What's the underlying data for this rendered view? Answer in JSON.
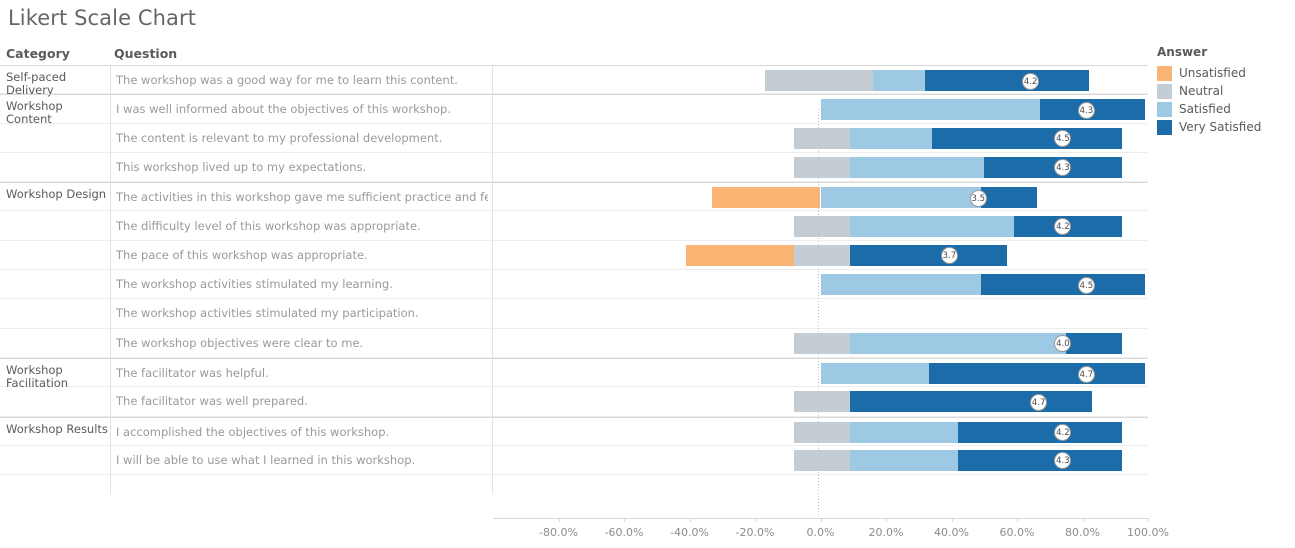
{
  "title": "Likert Scale Chart",
  "columns": {
    "category": "Category",
    "question": "Question"
  },
  "legend": {
    "title": "Answer",
    "items": [
      {
        "label": "Unsatisfied",
        "color": "#f9b474"
      },
      {
        "label": "Neutral",
        "color": "#c4ccd4"
      },
      {
        "label": "Satisfied",
        "color": "#9ec9e5"
      },
      {
        "label": "Very Satisfied",
        "color": "#1b6ca8"
      }
    ]
  },
  "axis": {
    "ticks": [
      "-80.0%",
      "-60.0%",
      "-40.0%",
      "-20.0%",
      "0.0%",
      "20.0%",
      "40.0%",
      "60.0%",
      "80.0%",
      "100.0%"
    ],
    "tick_values": [
      -80,
      -60,
      -40,
      -20,
      0,
      20,
      40,
      60,
      80,
      100
    ],
    "min": -100,
    "max": 100
  },
  "chart_data": {
    "type": "bar",
    "title": "Likert Scale Chart",
    "xlabel": "",
    "ylabel": "",
    "xlim": [
      -100,
      100
    ],
    "grid": false,
    "legend_position": "right",
    "stacked": true,
    "diverging": true,
    "series": [
      {
        "name": "Unsatisfied",
        "color": "#f9b474"
      },
      {
        "name": "Neutral",
        "color": "#c4ccd4"
      },
      {
        "name": "Satisfied",
        "color": "#9ec9e5"
      },
      {
        "name": "Very Satisfied",
        "color": "#1b6ca8"
      }
    ],
    "rows": [
      {
        "category": "Self-paced Delivery",
        "question": "The workshop was a good way for me to learn this content.",
        "score": "4.2",
        "start": -17,
        "segments": [
          {
            "name": "Unsatisfied",
            "value": 0
          },
          {
            "name": "Neutral",
            "value": 33
          },
          {
            "name": "Satisfied",
            "value": 16
          },
          {
            "name": "Very Satisfied",
            "value": 50
          }
        ]
      },
      {
        "category": "Workshop Content",
        "question": "I was well informed about the objectives of this workshop.",
        "score": "4.3",
        "start": 0,
        "segments": [
          {
            "name": "Unsatisfied",
            "value": 0
          },
          {
            "name": "Neutral",
            "value": 0
          },
          {
            "name": "Satisfied",
            "value": 67
          },
          {
            "name": "Very Satisfied",
            "value": 32
          }
        ]
      },
      {
        "category": "",
        "question": "The content is relevant to my professional development.",
        "score": "4.5",
        "start": -8,
        "segments": [
          {
            "name": "Unsatisfied",
            "value": 0
          },
          {
            "name": "Neutral",
            "value": 17
          },
          {
            "name": "Satisfied",
            "value": 25
          },
          {
            "name": "Very Satisfied",
            "value": 58
          }
        ]
      },
      {
        "category": "",
        "question": "This workshop lived up to my expectations.",
        "score": "4.3",
        "start": -8,
        "segments": [
          {
            "name": "Unsatisfied",
            "value": 0
          },
          {
            "name": "Neutral",
            "value": 17
          },
          {
            "name": "Satisfied",
            "value": 41
          },
          {
            "name": "Very Satisfied",
            "value": 42
          }
        ]
      },
      {
        "category": "Workshop Design",
        "question": "The activities in this workshop gave me sufficient practice and feedback.",
        "score": "3.5",
        "start": -33,
        "segments": [
          {
            "name": "Unsatisfied",
            "value": 33
          },
          {
            "name": "Neutral",
            "value": 0
          },
          {
            "name": "Satisfied",
            "value": 49
          },
          {
            "name": "Very Satisfied",
            "value": 17
          }
        ]
      },
      {
        "category": "",
        "question": "The difficulty level of this workshop was appropriate.",
        "score": "4.2",
        "start": -8,
        "segments": [
          {
            "name": "Unsatisfied",
            "value": 0
          },
          {
            "name": "Neutral",
            "value": 17
          },
          {
            "name": "Satisfied",
            "value": 50
          },
          {
            "name": "Very Satisfied",
            "value": 33
          }
        ]
      },
      {
        "category": "",
        "question": "The pace of this workshop was appropriate.",
        "score": "3.7",
        "start": -41,
        "segments": [
          {
            "name": "Unsatisfied",
            "value": 33
          },
          {
            "name": "Neutral",
            "value": 17
          },
          {
            "name": "Satisfied",
            "value": 0
          },
          {
            "name": "Very Satisfied",
            "value": 48
          }
        ]
      },
      {
        "category": "",
        "question": "The workshop activities stimulated my learning.",
        "score": "4.5",
        "start": 0,
        "segments": [
          {
            "name": "Unsatisfied",
            "value": 0
          },
          {
            "name": "Neutral",
            "value": 0
          },
          {
            "name": "Satisfied",
            "value": 49
          },
          {
            "name": "Very Satisfied",
            "value": 50
          }
        ]
      },
      {
        "category": "",
        "question": "The workshop activities stimulated my participation.",
        "score": "",
        "start": 0,
        "segments": [
          {
            "name": "Unsatisfied",
            "value": 0
          },
          {
            "name": "Neutral",
            "value": 0
          },
          {
            "name": "Satisfied",
            "value": 0
          },
          {
            "name": "Very Satisfied",
            "value": 0
          }
        ]
      },
      {
        "category": "",
        "question": "The workshop objectives were clear to me.",
        "score": "4.0",
        "start": -8,
        "segments": [
          {
            "name": "Unsatisfied",
            "value": 0
          },
          {
            "name": "Neutral",
            "value": 17
          },
          {
            "name": "Satisfied",
            "value": 66
          },
          {
            "name": "Very Satisfied",
            "value": 17
          }
        ]
      },
      {
        "category": "Workshop Facilitation",
        "question": "The facilitator was helpful.",
        "score": "4.7",
        "start": 0,
        "segments": [
          {
            "name": "Unsatisfied",
            "value": 0
          },
          {
            "name": "Neutral",
            "value": 0
          },
          {
            "name": "Satisfied",
            "value": 33
          },
          {
            "name": "Very Satisfied",
            "value": 66
          }
        ]
      },
      {
        "category": "",
        "question": "The facilitator was well prepared.",
        "score": "4.7",
        "start": -8,
        "segments": [
          {
            "name": "Unsatisfied",
            "value": 0
          },
          {
            "name": "Neutral",
            "value": 17
          },
          {
            "name": "Satisfied",
            "value": 0
          },
          {
            "name": "Very Satisfied",
            "value": 74
          }
        ]
      },
      {
        "category": "Workshop Results",
        "question": "I accomplished the objectives of this workshop.",
        "score": "4.2",
        "start": -8,
        "segments": [
          {
            "name": "Unsatisfied",
            "value": 0
          },
          {
            "name": "Neutral",
            "value": 17
          },
          {
            "name": "Satisfied",
            "value": 33
          },
          {
            "name": "Very Satisfied",
            "value": 50
          }
        ]
      },
      {
        "category": "",
        "question": "I will be able to use what I learned in this workshop.",
        "score": "4.3",
        "start": -8,
        "segments": [
          {
            "name": "Unsatisfied",
            "value": 0
          },
          {
            "name": "Neutral",
            "value": 17
          },
          {
            "name": "Satisfied",
            "value": 33
          },
          {
            "name": "Very Satisfied",
            "value": 50
          }
        ]
      }
    ]
  }
}
